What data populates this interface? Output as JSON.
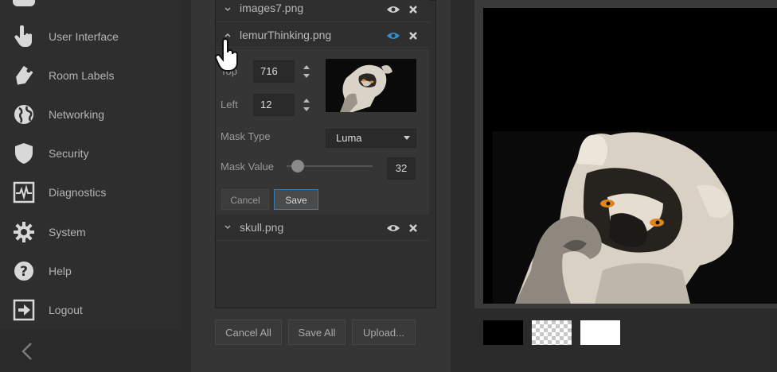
{
  "sidebar": {
    "items": [
      {
        "label": "User Interface",
        "icon": "hand-pointer-icon"
      },
      {
        "label": "Room Labels",
        "icon": "tag-icon"
      },
      {
        "label": "Networking",
        "icon": "globe-icon"
      },
      {
        "label": "Security",
        "icon": "shield-icon"
      },
      {
        "label": "Diagnostics",
        "icon": "pulse-icon"
      },
      {
        "label": "System",
        "icon": "gear-icon"
      },
      {
        "label": "Help",
        "icon": "question-icon"
      },
      {
        "label": "Logout",
        "icon": "logout-icon"
      }
    ],
    "collapse_icon": "chevron-left-icon"
  },
  "layers": {
    "items": [
      {
        "name": "images7.png",
        "expanded": false
      },
      {
        "name": "lemurThinking.png",
        "expanded": true,
        "visible_active": true
      },
      {
        "name": "skull.png",
        "expanded": false
      }
    ],
    "editor": {
      "top_label": "Top",
      "top_value": "716",
      "left_label": "Left",
      "left_value": "12",
      "mask_type_label": "Mask Type",
      "mask_type_value": "Luma",
      "mask_value_label": "Mask Value",
      "mask_value": "32",
      "cancel_label": "Cancel",
      "save_label": "Save"
    }
  },
  "footer": {
    "cancel_all": "Cancel All",
    "save_all": "Save All",
    "upload": "Upload..."
  },
  "colors": {
    "accent": "#2d8fd6",
    "background": "#2b2b2b"
  }
}
